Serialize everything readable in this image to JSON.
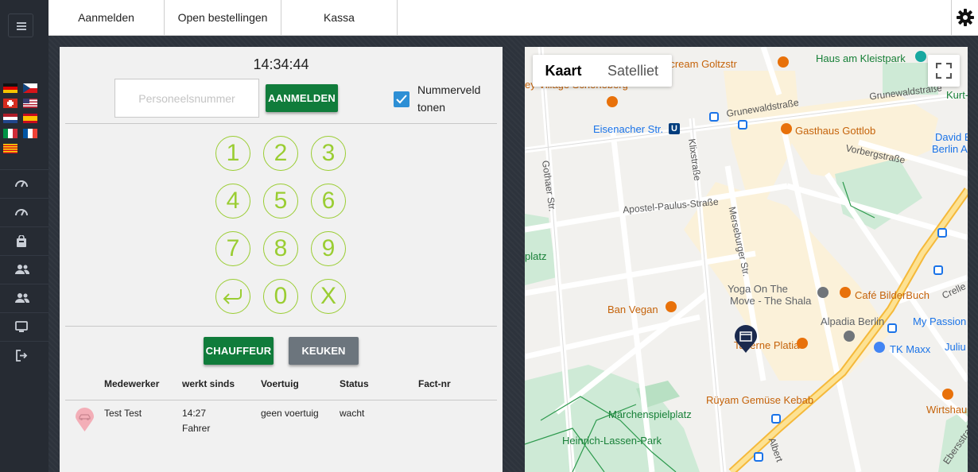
{
  "sidebar": {
    "menu_icon": "hamburger-icon",
    "flags": [
      "german-flag",
      "czech-flag",
      "swiss-flag",
      "us-flag",
      "dutch-flag",
      "spanish-flag",
      "italian-flag",
      "french-flag",
      "catalan-flag"
    ],
    "nav_icons": [
      "dashboard-icon",
      "dashboard-icon",
      "shopping-bag-icon",
      "users-icon",
      "users-icon",
      "monitor-icon",
      "logout-icon"
    ]
  },
  "topbar": {
    "tabs": [
      "Aanmelden",
      "Open bestellingen",
      "Kassa"
    ],
    "settings_icon": "gear-icon"
  },
  "login": {
    "time": "14:34:44",
    "pin_placeholder": "Personeelsnummer",
    "pin_value": "",
    "login_button": "AANMELDEN",
    "show_number_checkbox": true,
    "show_number_label": "Nummerveld tonen",
    "keypad": [
      "1",
      "2",
      "3",
      "4",
      "5",
      "6",
      "7",
      "8",
      "9",
      "↩",
      "0",
      "X"
    ],
    "role_buttons": [
      "CHAUFFEUR",
      "KEUKEN"
    ]
  },
  "staff_table": {
    "columns": [
      "Medewerker",
      "werkt sinds",
      "Voertuig",
      "Status",
      "Fact-nr"
    ],
    "rows": [
      {
        "icon": "car-pin-icon",
        "name": "Test Test",
        "since": "14:27",
        "role": "Fahrer",
        "vehicle": "geen voertuig",
        "status": "wacht",
        "invoice": ""
      }
    ]
  },
  "map": {
    "type_tabs": [
      "Kaart",
      "Satelliet"
    ],
    "selected_tab": "Kaart",
    "fullscreen_icon": "fullscreen-icon",
    "streets": [
      "Grunewaldstraße",
      "Grunewaldstraße",
      "Vorbergstraße",
      "Apostel-Paulus-Straße",
      "Gothaer Str.",
      "Klixstraße",
      "Merseburger Str.",
      "Albert",
      "Ebersstraße",
      "Crelle",
      "Eisenacher Str."
    ],
    "pois": [
      "Haus am Kleistpark",
      "s ice cream Goltzstr",
      "ey Village Schöneberg",
      "Gasthaus Gottlob",
      "David Bo",
      "Berlin Apar",
      "Kurt-Hi",
      "Yoga On The",
      "Move - The Shala",
      "Café BilderBuch",
      "Ban Vegan",
      "Alpadia Berlin",
      "My Passion",
      "Taverne Platia",
      "TK Maxx",
      "Juliu",
      "Rüyam Gemüse Kebab",
      "Wirtshaus",
      "Märchenspielplatz",
      "Heinrich-Lassen-Park",
      "platz"
    ]
  }
}
